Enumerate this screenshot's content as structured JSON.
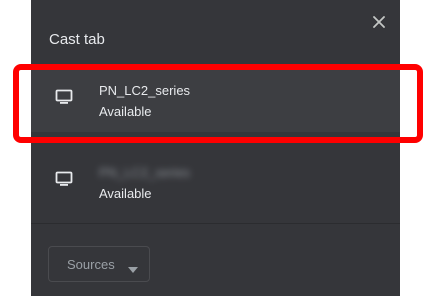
{
  "dialog": {
    "title": "Cast tab",
    "close_icon": "close-icon"
  },
  "sinks": [
    {
      "icon": "monitor-icon",
      "name": "PN_LC2_series",
      "status": "Available",
      "highlighted": true
    },
    {
      "icon": "monitor-icon",
      "name": "PN_LC2_series",
      "status": "Available",
      "name_obscured": true
    }
  ],
  "footer": {
    "sources_label": "Sources",
    "sources_icon": "caret-down-icon"
  },
  "annotation": {
    "color": "#ff0000",
    "target": "sink-1"
  },
  "colors": {
    "dialog_background": "#35363a",
    "text_primary": "#e8eaed",
    "text_secondary": "#9aa0a6"
  }
}
